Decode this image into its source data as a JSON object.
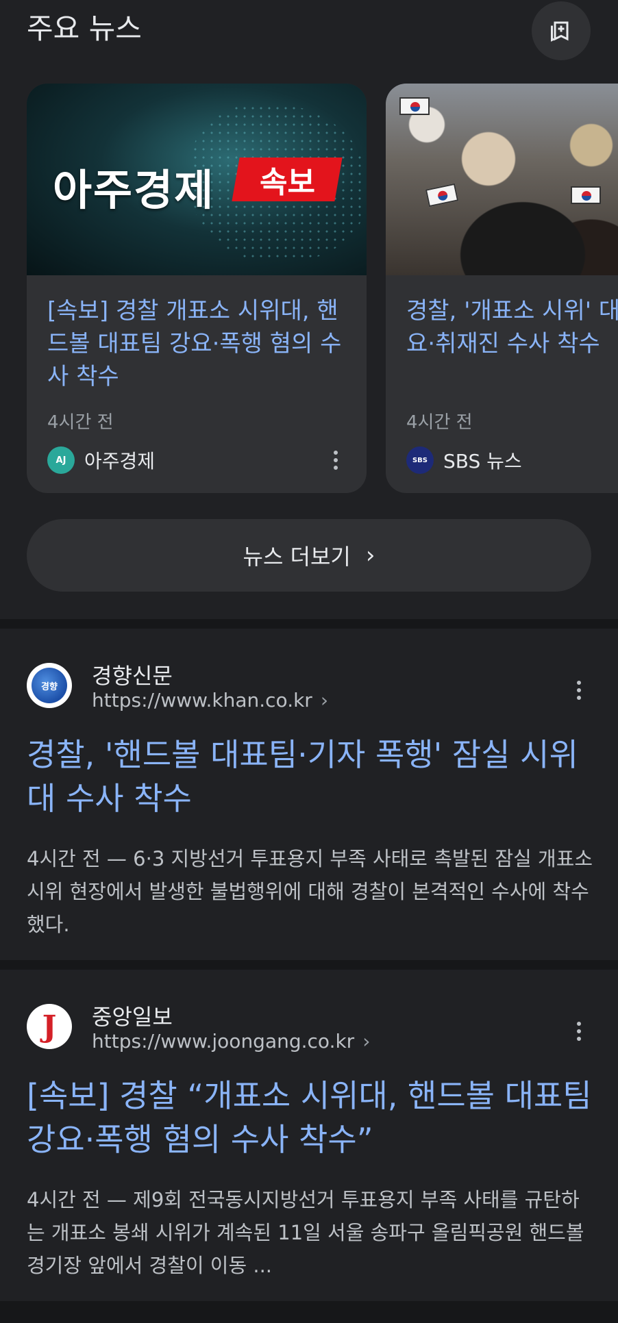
{
  "top_news": {
    "title": "주요 뉴스",
    "save_icon": "bookmark-stack-icon",
    "cards": [
      {
        "image_brand_text": "아주경제",
        "image_badge_text": "속보",
        "headline": "[속보] 경찰 개표소 시위대, 핸드볼 대표팀 강요·폭행 혐의 수사 착수",
        "time": "4시간 전",
        "source": "아주경제",
        "source_logo_text": "AJ"
      },
      {
        "headline": "경찰, '개표소 시위' 대표팀 강요·취재진 수사 착수",
        "time": "4시간 전",
        "source": "SBS 뉴스",
        "source_logo_text": "SBS"
      }
    ],
    "more_button_label": "뉴스 더보기",
    "more_chevron": "›"
  },
  "results": [
    {
      "site_name": "경향신문",
      "logo_text": "경향",
      "url": "https://www.khan.co.kr",
      "url_chevron": "›",
      "title": "경찰, '핸드볼 대표팀·기자 폭행' 잠실 시위대 수사 착수",
      "snippet": "4시간 전 — 6·3 지방선거 투표용지 부족 사태로 촉발된 잠실 개표소 시위 현장에서 발생한 불법행위에 대해 경찰이 본격적인 수사에 착수했다."
    },
    {
      "site_name": "중앙일보",
      "logo_text": "J",
      "url": "https://www.joongang.co.kr",
      "url_chevron": "›",
      "title": "[속보] 경찰 “개표소 시위대, 핸드볼 대표팀 강요·폭행 혐의 수사 착수”",
      "snippet": "4시간 전 — 제9회 전국동시지방선거 투표용지 부족 사태를 규탄하는 개표소 봉쇄 시위가 계속된 11일 서울 송파구 올림픽공원 핸드볼경기장 앞에서 경찰이 이동 ..."
    }
  ],
  "colors": {
    "background": "#202124",
    "card": "#303134",
    "link": "#8ab4f8",
    "text": "#e8eaed",
    "muted": "#9aa0a6"
  }
}
